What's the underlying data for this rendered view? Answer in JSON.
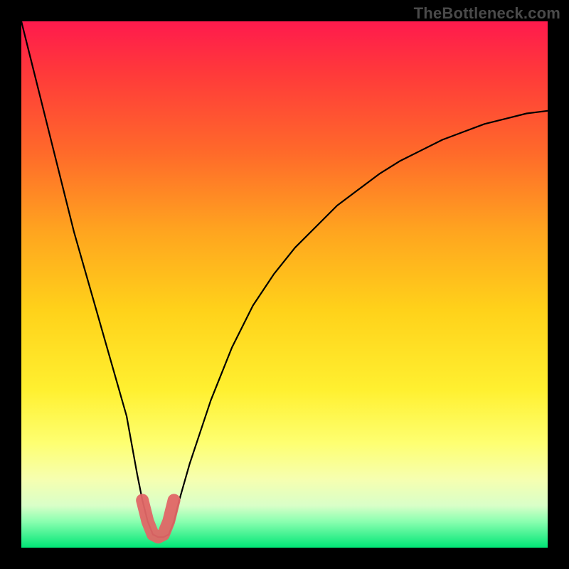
{
  "watermark": "TheBottleneck.com",
  "chart_data": {
    "type": "line",
    "title": "",
    "xlabel": "",
    "ylabel": "",
    "xlim": [
      0,
      100
    ],
    "ylim": [
      0,
      100
    ],
    "grid": false,
    "legend": false,
    "x": [
      0,
      2,
      4,
      6,
      8,
      10,
      12,
      14,
      16,
      18,
      20,
      22,
      23,
      24,
      25,
      26,
      27,
      28,
      29,
      30,
      32,
      34,
      36,
      38,
      40,
      44,
      48,
      52,
      56,
      60,
      64,
      68,
      72,
      76,
      80,
      84,
      88,
      92,
      96,
      100
    ],
    "series": [
      {
        "name": "bottleneck-curve",
        "values": [
          100,
          92,
          84,
          76,
          68,
          60,
          53,
          46,
          39,
          32,
          25,
          14,
          9,
          5,
          2.5,
          2,
          2,
          2.5,
          5,
          9,
          16,
          22,
          28,
          33,
          38,
          46,
          52,
          57,
          61,
          65,
          68,
          71,
          73.5,
          75.5,
          77.5,
          79,
          80.5,
          81.5,
          82.5,
          83
        ]
      }
    ],
    "highlight": {
      "name": "min-region",
      "x": [
        23,
        24,
        25,
        26,
        27,
        28,
        29
      ],
      "values": [
        9,
        5,
        2.5,
        2,
        2.5,
        5,
        9
      ],
      "color": "#e06666"
    }
  }
}
